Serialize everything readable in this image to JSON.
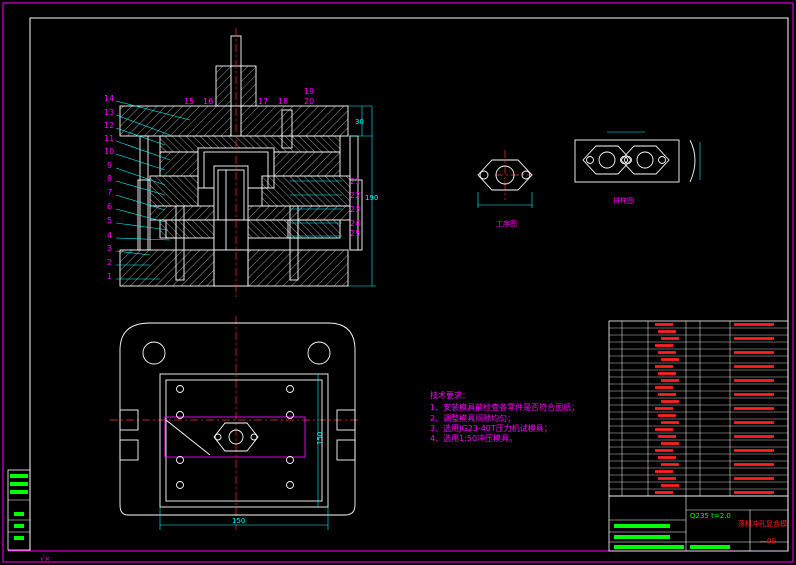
{
  "colors": {
    "background": "#000000",
    "frame": "#ff00ff",
    "lines": "#ffffff",
    "hatch": "#ffffff",
    "centerline": "#ff3030",
    "labels": "#ff00ff",
    "dimensions": "#00ffff",
    "notes": "#ff00ff",
    "table_text": "#ff2020",
    "table_fill": "#00ff00"
  },
  "part_numbers_left": [
    "14",
    "13",
    "12",
    "11",
    "10",
    "9",
    "8",
    "7",
    "6",
    "5",
    "4",
    "3",
    "2",
    "1"
  ],
  "part_numbers_top": [
    "15",
    "16",
    "17",
    "18",
    "19",
    "20"
  ],
  "part_numbers_right": [
    "21",
    "22",
    "23",
    "24",
    "25"
  ],
  "section_dimensions": [
    "30",
    "190"
  ],
  "workpiece_label": "工序图",
  "strip_label": "排样图",
  "plan_dimensions": [
    "150",
    "150"
  ],
  "tech_requirements": {
    "title": "技术要求：",
    "items": [
      "1、安装模具前检查各零件是否符合图纸；",
      "2、调整模具间隙均匀；",
      "3、选用JG23-40T压力机试模具；",
      "4、选用1:50冲压模具。"
    ]
  },
  "title_block": {
    "material": "Q235 t=2.0",
    "drawing_title": "落料冲孔复合模",
    "drawing_no": "—00"
  }
}
